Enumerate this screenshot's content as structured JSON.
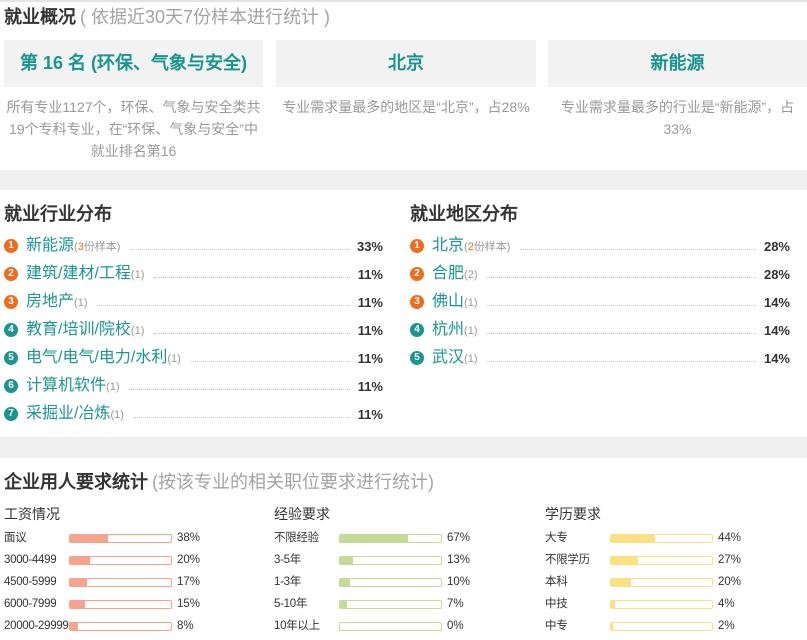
{
  "colors": {
    "teal": "#1a958f",
    "orange": "#f06b1c",
    "badge_top": "#f06b1c",
    "badge_rest": "#1a958f"
  },
  "overview": {
    "title": "就业概况",
    "subtitle": "( 依据近30天7份样本进行统计 )",
    "cards": [
      {
        "headline": "第 16 名 (环保、气象与安全)",
        "desc": "所有专业1127个，环保、气象与安全类共19个专科专业，在“环保、气象与安全”中就业排名第16"
      },
      {
        "headline": "北京",
        "desc": "专业需求量最多的地区是“北京”，占28%"
      },
      {
        "headline": "新能源",
        "desc": "专业需求量最多的行业是“新能源”，占33%"
      }
    ]
  },
  "industry": {
    "title": "就业行业分布",
    "items": [
      {
        "rank": "1",
        "name": "新能源",
        "count_pre": "(",
        "count_num": "3",
        "count_post": "份样本)",
        "count_num_color": "#f06b1c",
        "pct": "33%"
      },
      {
        "rank": "2",
        "name": "建筑/建材/工程",
        "count_pre": "(",
        "count_num": "1",
        "count_post": ")",
        "pct": "11%"
      },
      {
        "rank": "3",
        "name": "房地产",
        "count_pre": "(",
        "count_num": "1",
        "count_post": ")",
        "pct": "11%"
      },
      {
        "rank": "4",
        "name": "教育/培训/院校",
        "count_pre": "(",
        "count_num": "1",
        "count_post": ")",
        "pct": "11%"
      },
      {
        "rank": "5",
        "name": "电气/电气/电力/水利",
        "count_pre": "(",
        "count_num": "1",
        "count_post": ")",
        "pct": "11%"
      },
      {
        "rank": "6",
        "name": "计算机软件",
        "count_pre": "(",
        "count_num": "1",
        "count_post": ")",
        "pct": "11%"
      },
      {
        "rank": "7",
        "name": "采掘业/冶炼",
        "count_pre": "(",
        "count_num": "1",
        "count_post": ")",
        "pct": "11%"
      }
    ]
  },
  "region": {
    "title": "就业地区分布",
    "items": [
      {
        "rank": "1",
        "name": "北京",
        "count_pre": "(",
        "count_num": "2",
        "count_post": "份样本)",
        "count_num_color": "#f06b1c",
        "pct": "28%"
      },
      {
        "rank": "2",
        "name": "合肥",
        "count_pre": "(",
        "count_num": "2",
        "count_post": ")",
        "pct": "28%"
      },
      {
        "rank": "3",
        "name": "佛山",
        "count_pre": "(",
        "count_num": "1",
        "count_post": ")",
        "pct": "14%"
      },
      {
        "rank": "4",
        "name": "杭州",
        "count_pre": "(",
        "count_num": "1",
        "count_post": ")",
        "pct": "14%"
      },
      {
        "rank": "5",
        "name": "武汉",
        "count_pre": "(",
        "count_num": "1",
        "count_post": ")",
        "pct": "14%"
      }
    ]
  },
  "requirements": {
    "title": "企业用人要求统计",
    "subtitle": "(按该专业的相关职位要求进行统计)",
    "groups": [
      {
        "title": "工资情况",
        "bar_color": "#f5a38c",
        "rows": [
          {
            "label": "面议",
            "pct": "38%"
          },
          {
            "label": "3000-4499",
            "pct": "20%"
          },
          {
            "label": "4500-5999",
            "pct": "17%"
          },
          {
            "label": "6000-7999",
            "pct": "15%"
          },
          {
            "label": "20000-29999",
            "pct": "8%"
          }
        ]
      },
      {
        "title": "经验要求",
        "bar_color": "#c4db96",
        "rows": [
          {
            "label": "不限经验",
            "pct": "67%"
          },
          {
            "label": "3-5年",
            "pct": "13%"
          },
          {
            "label": "1-3年",
            "pct": "10%"
          },
          {
            "label": "5-10年",
            "pct": "7%"
          },
          {
            "label": "10年以上",
            "pct": "0%"
          }
        ]
      },
      {
        "title": "学历要求",
        "bar_color": "#fce183",
        "rows": [
          {
            "label": "大专",
            "pct": "44%"
          },
          {
            "label": "不限学历",
            "pct": "27%"
          },
          {
            "label": "本科",
            "pct": "20%"
          },
          {
            "label": "中技",
            "pct": "4%"
          },
          {
            "label": "中专",
            "pct": "2%"
          }
        ]
      }
    ]
  }
}
